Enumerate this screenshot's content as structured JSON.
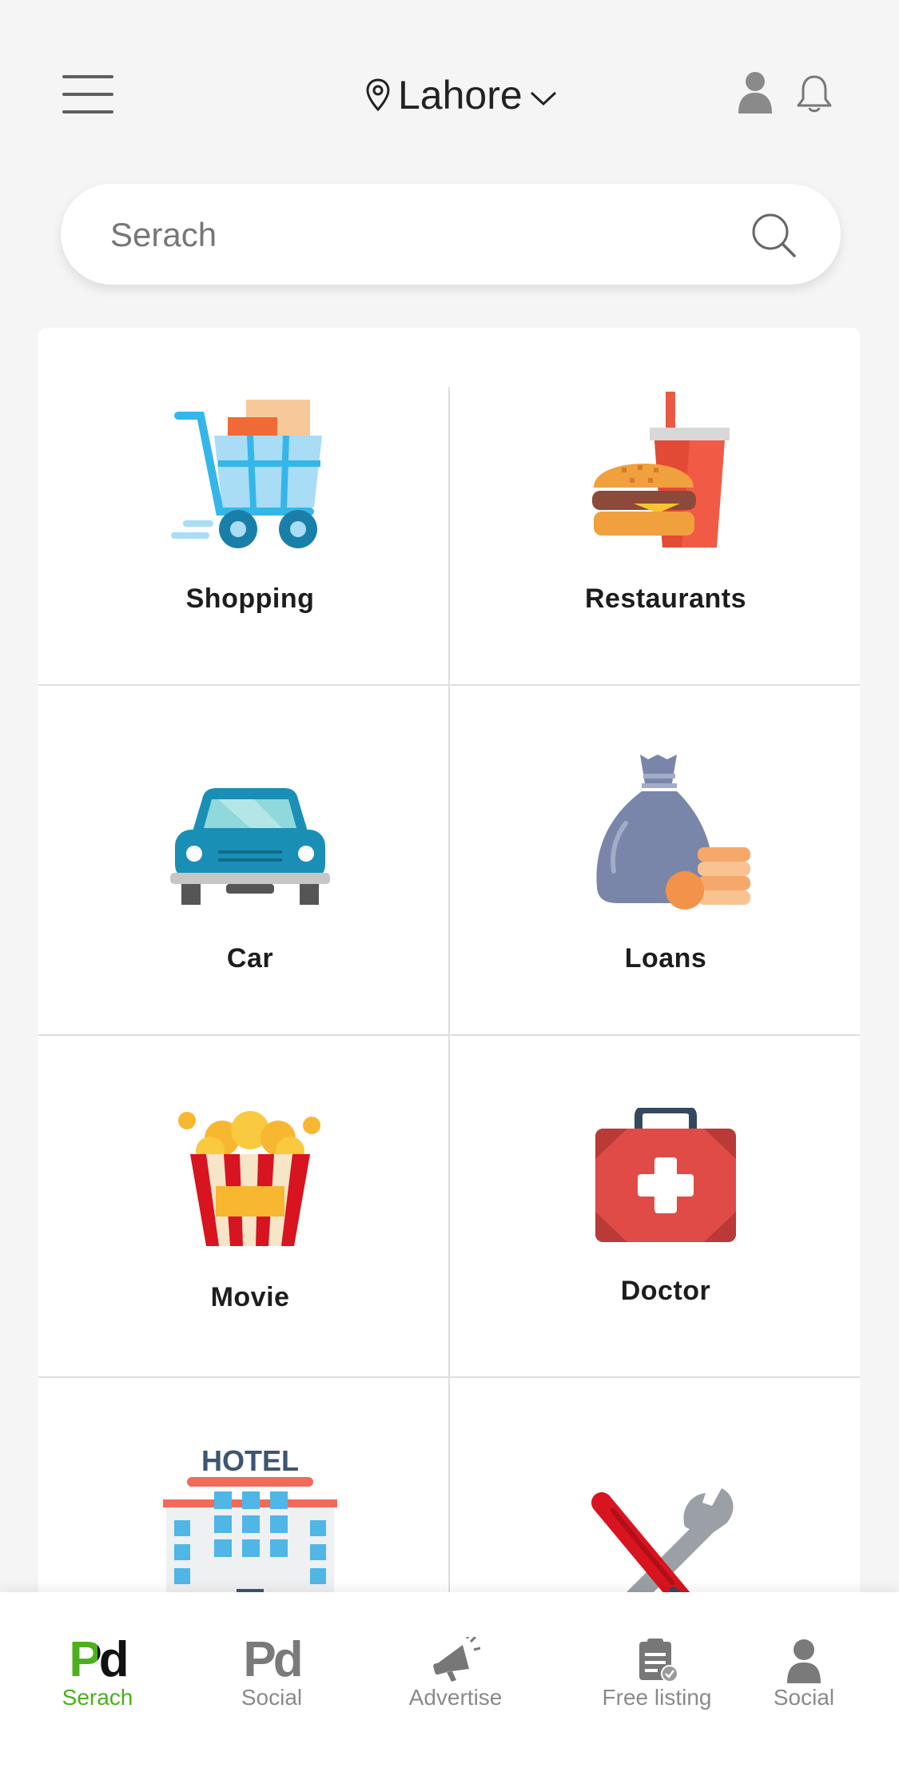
{
  "header": {
    "location": "Lahore",
    "menu_icon": "hamburger-menu-icon",
    "location_icon": "map-pin-icon",
    "dropdown_icon": "chevron-down-icon",
    "profile_icon": "user-icon",
    "notification_icon": "bell-icon"
  },
  "search": {
    "placeholder": "Serach",
    "icon": "search-icon"
  },
  "categories": [
    {
      "label": "Shopping",
      "icon": "shopping-cart-icon"
    },
    {
      "label": "Restaurants",
      "icon": "burger-drink-icon"
    },
    {
      "label": "Car",
      "icon": "car-icon"
    },
    {
      "label": "Loans",
      "icon": "money-bag-icon"
    },
    {
      "label": "Movie",
      "icon": "popcorn-icon"
    },
    {
      "label": "Doctor",
      "icon": "first-aid-kit-icon"
    },
    {
      "label": "",
      "icon": "hotel-icon",
      "sign_text": "HOTEL"
    },
    {
      "label": "",
      "icon": "tools-icon"
    }
  ],
  "bottom_nav": {
    "items": [
      {
        "label": "Serach",
        "icon": "pd-logo-icon",
        "logo_text": "Pd",
        "active": true
      },
      {
        "label": "Social",
        "icon": "pd-logo-icon",
        "logo_text": "Pd",
        "active": false
      },
      {
        "label": "Advertise",
        "icon": "megaphone-icon",
        "active": false
      },
      {
        "label": "Free listing",
        "icon": "clipboard-check-icon",
        "active": false
      },
      {
        "label": "Social",
        "icon": "user-icon",
        "active": false
      }
    ]
  },
  "colors": {
    "accent": "#4caf1b",
    "background": "#f5f5f5",
    "nav_inactive": "#8a8a8a"
  }
}
